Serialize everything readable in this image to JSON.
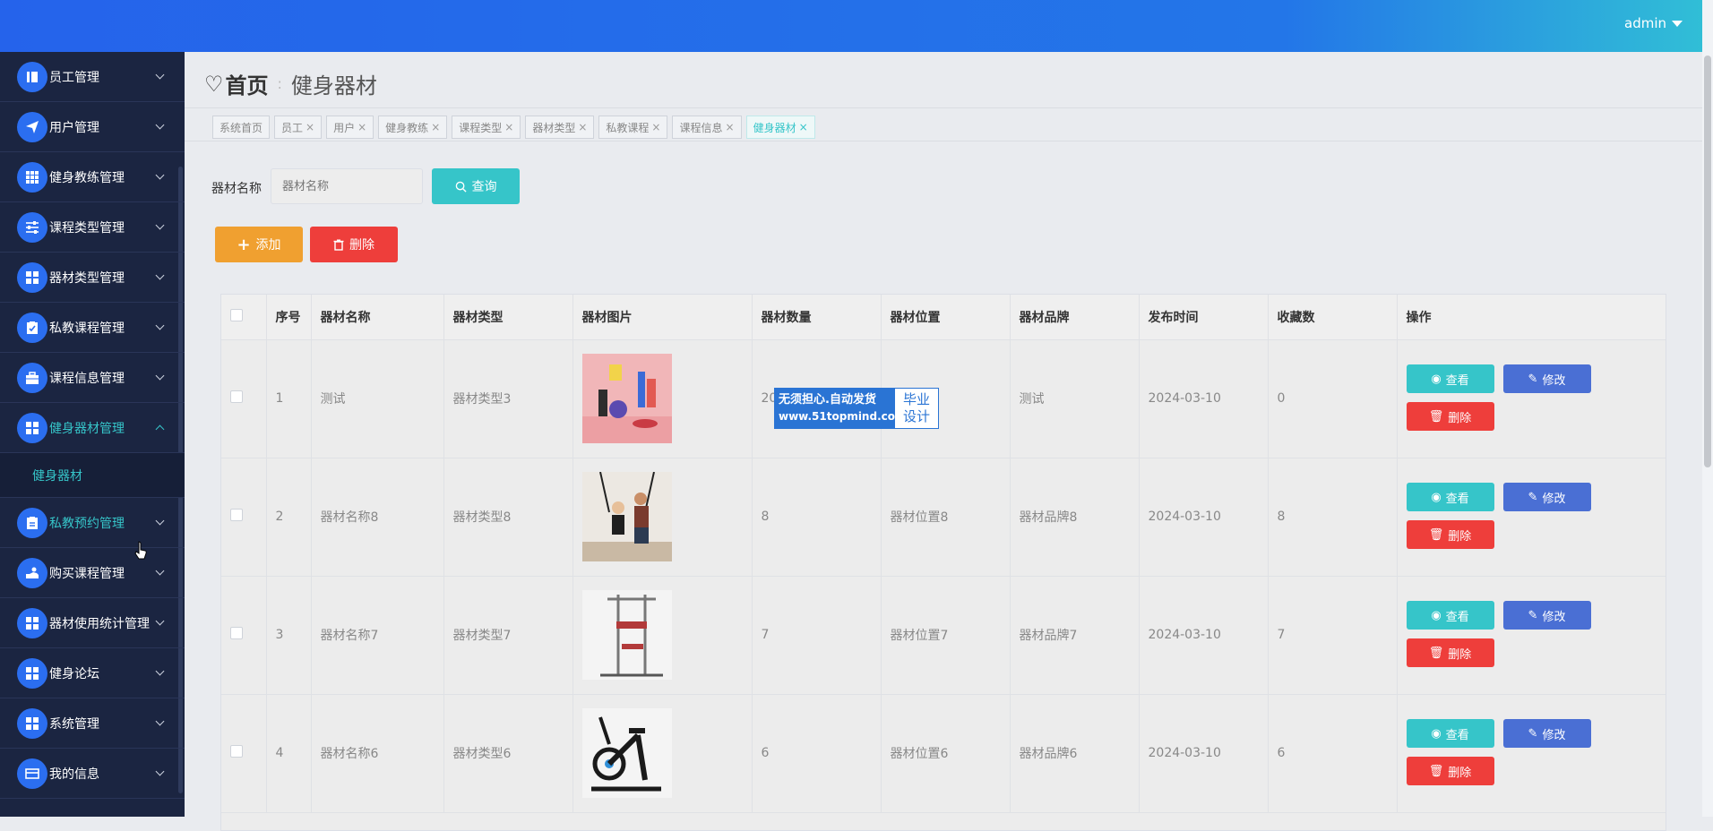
{
  "header": {
    "user": "admin",
    "accent": "#2563eb"
  },
  "sidebar": {
    "items": [
      {
        "label": "员工管理",
        "icon": "book-icon"
      },
      {
        "label": "用户管理",
        "icon": "paper-plane-icon"
      },
      {
        "label": "健身教练管理",
        "icon": "grid-icon"
      },
      {
        "label": "课程类型管理",
        "icon": "sliders-icon"
      },
      {
        "label": "器材类型管理",
        "icon": "grid-icon"
      },
      {
        "label": "私教课程管理",
        "icon": "clipboard-icon"
      },
      {
        "label": "课程信息管理",
        "icon": "briefcase-icon"
      },
      {
        "label": "健身器材管理",
        "icon": "grid-icon"
      },
      {
        "label": "私教预约管理",
        "icon": "clipboard-icon"
      },
      {
        "label": "购买课程管理",
        "icon": "hand-icon"
      },
      {
        "label": "器材使用统计管理",
        "icon": "grid-icon"
      },
      {
        "label": "健身论坛",
        "icon": "grid-icon"
      },
      {
        "label": "系统管理",
        "icon": "grid-icon"
      },
      {
        "label": "我的信息",
        "icon": "card-icon"
      }
    ],
    "submenu_label": "健身器材"
  },
  "breadcrumb": {
    "home": "首页",
    "current": "健身器材"
  },
  "tabs": [
    {
      "label": "系统首页",
      "closable": false
    },
    {
      "label": "员工",
      "closable": true
    },
    {
      "label": "用户",
      "closable": true
    },
    {
      "label": "健身教练",
      "closable": true
    },
    {
      "label": "课程类型",
      "closable": true
    },
    {
      "label": "器材类型",
      "closable": true
    },
    {
      "label": "私教课程",
      "closable": true
    },
    {
      "label": "课程信息",
      "closable": true
    },
    {
      "label": "健身器材",
      "closable": true
    }
  ],
  "search": {
    "label": "器材名称",
    "placeholder": "器材名称",
    "query_label": "查询"
  },
  "actions": {
    "add_label": "添加",
    "delete_label": "删除"
  },
  "table": {
    "columns": [
      "序号",
      "器材名称",
      "器材类型",
      "器材图片",
      "器材数量",
      "器材位置",
      "器材品牌",
      "发布时间",
      "收藏数",
      "操作"
    ],
    "rows": [
      {
        "idx": "1",
        "name": "测试",
        "type": "器材类型3",
        "image": "pink-room-photo",
        "qty": "20",
        "loc": "",
        "brand": "测试",
        "date": "2024-03-10",
        "fav": "0"
      },
      {
        "idx": "2",
        "name": "器材名称8",
        "type": "器材类型8",
        "image": "trx-training-photo",
        "qty": "8",
        "loc": "器材位置8",
        "brand": "器材品牌8",
        "date": "2024-03-10",
        "fav": "8"
      },
      {
        "idx": "3",
        "name": "器材名称7",
        "type": "器材类型7",
        "image": "power-tower-photo",
        "qty": "7",
        "loc": "器材位置7",
        "brand": "器材品牌7",
        "date": "2024-03-10",
        "fav": "7"
      },
      {
        "idx": "4",
        "name": "器材名称6",
        "type": "器材类型6",
        "image": "spin-bike-photo",
        "qty": "6",
        "loc": "器材位置6",
        "brand": "器材品牌6",
        "date": "2024-03-10",
        "fav": "6"
      }
    ],
    "op_view": "查看",
    "op_edit": "修改",
    "op_delete": "删除"
  },
  "watermark": {
    "line1": "无须担心.自动发货",
    "line2": "www.51topmind.com",
    "right1": "毕业",
    "right2": "设计"
  }
}
